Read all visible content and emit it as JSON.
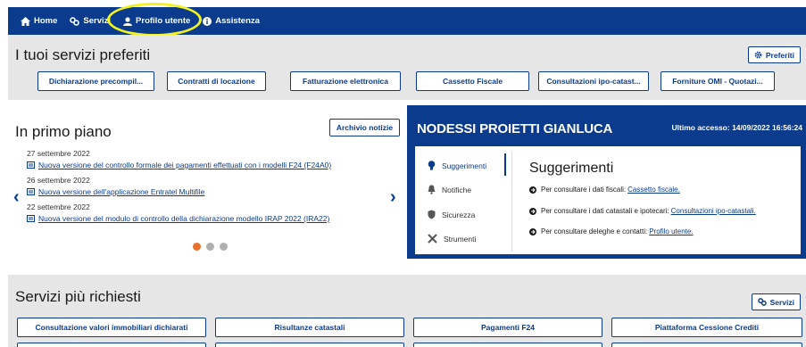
{
  "nav": {
    "home": "Home",
    "servizi": "Servizi",
    "profilo": "Profilo utente",
    "assistenza": "Assistenza"
  },
  "favorites": {
    "title": "I tuoi servizi preferiti",
    "button": "Preferiti",
    "items": [
      "Dichiarazione precompil...",
      "Contratti di locazione",
      "Fatturazione elettronica",
      "Cassetto Fiscale",
      "Consultazioni ipo-catast...",
      "Forniture OMI - Quotazi..."
    ]
  },
  "news": {
    "title": "In primo piano",
    "archive_button": "Archivio notizie",
    "items": [
      {
        "date": "27 settembre 2022",
        "text": "Nuova versione del controllo formale dei pagamenti effettuati con i modelli F24 (F24A0)"
      },
      {
        "date": "26 settembre 2022",
        "text": "Nuova versione dell'applicazione Entratel Multifile"
      },
      {
        "date": "22 settembre 2022",
        "text": " Nuova versione del modulo di controllo della dichiarazione modello IRAP 2022 (IRA22)"
      }
    ],
    "prev": "‹",
    "next": "›"
  },
  "user": {
    "name": "NODESSI PROIETTI GIANLUCA",
    "last_access": "Ultimo accesso: 14/09/2022 16:56:24",
    "tabs": [
      "Suggerimenti",
      "Notifiche",
      "Sicurezza",
      "Strumenti"
    ],
    "suggestions_title": "Suggerimenti",
    "suggestions": [
      {
        "text": "Per consultare i dati fiscali:",
        "link": "Cassetto fiscale."
      },
      {
        "text": "Per consultare i dati catastali e ipotecari:",
        "link": "Consultazioni ipo-catastali."
      },
      {
        "text": "Per consultare deleghe e contatti:",
        "link": "Profilo utente."
      }
    ]
  },
  "requested": {
    "title": "Servizi più richiesti",
    "button": "Servizi",
    "items": [
      "Consultazione valori immobiliari dichiarati",
      "Risultanze catastali",
      "Pagamenti F24",
      "Piattaforma Cessione Crediti"
    ]
  },
  "colors": {
    "primary": "#0b3b8c",
    "section_bg": "#e6e6e6",
    "highlight": "#f2f21f",
    "active_dot": "#e8702a"
  }
}
